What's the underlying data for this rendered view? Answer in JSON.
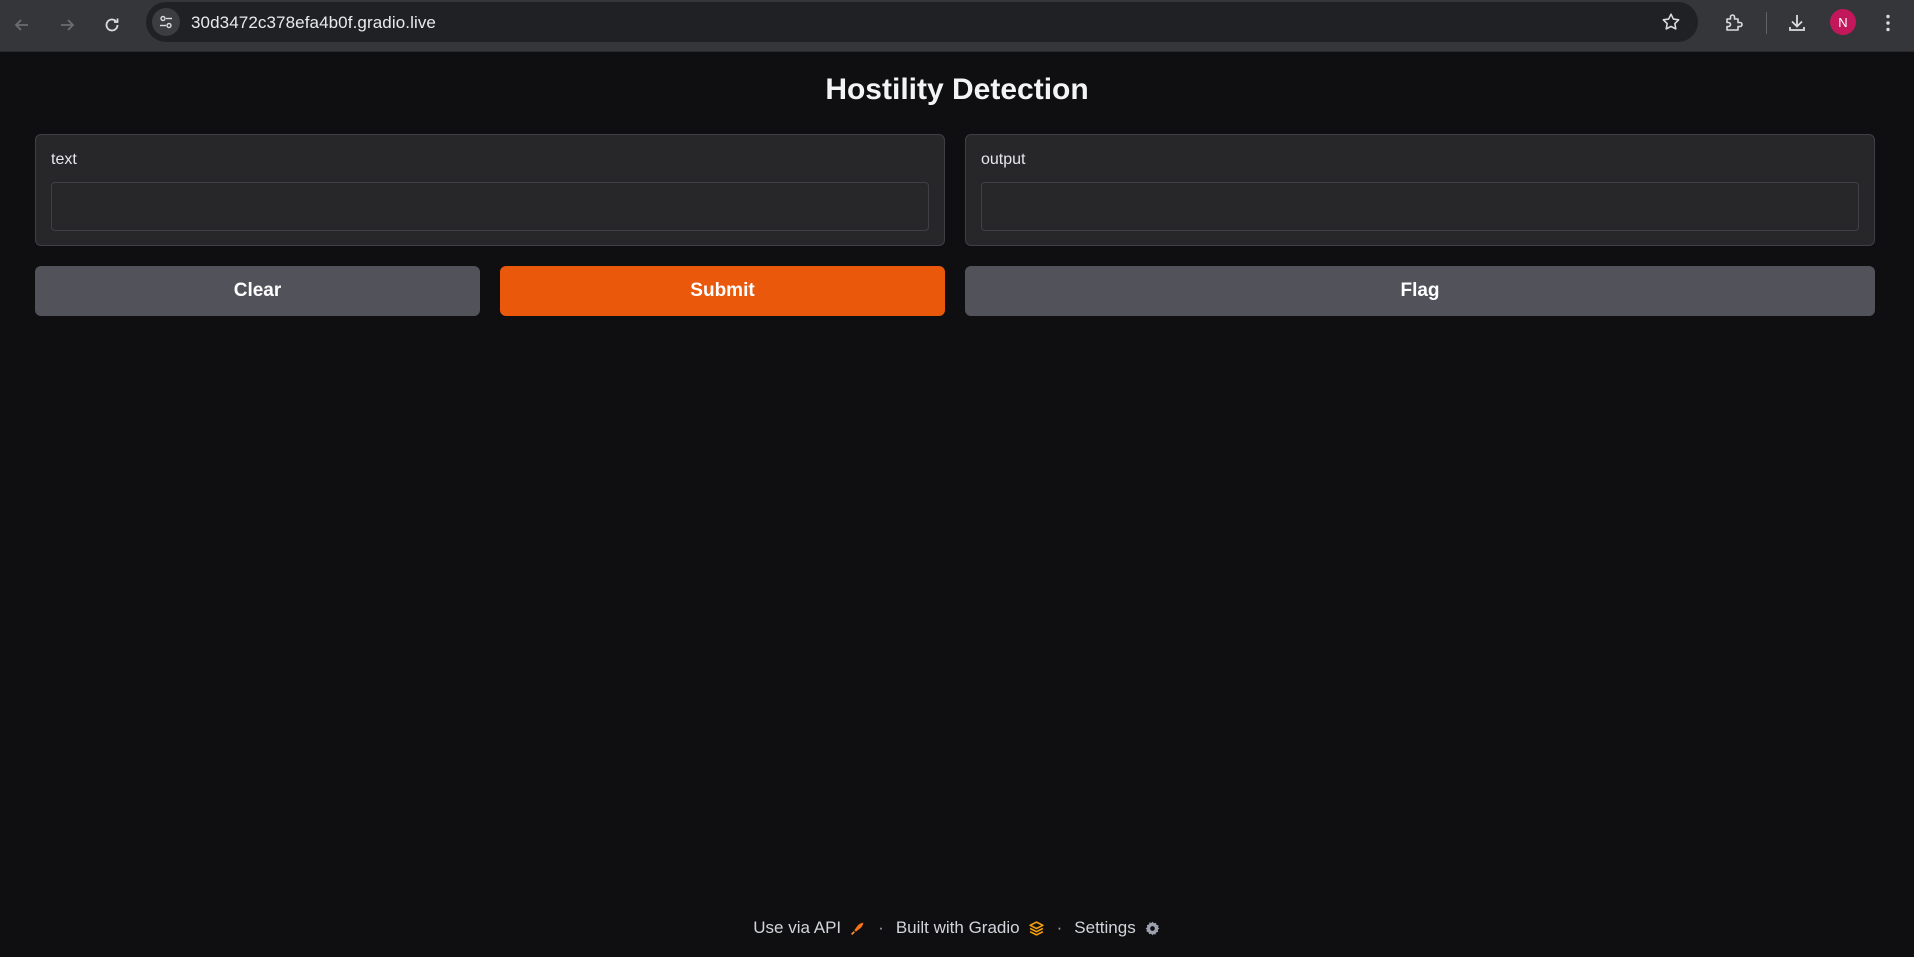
{
  "browser": {
    "url": "30d3472c378efa4b0f.gradio.live",
    "profile_initial": "N",
    "profile_color": "#c2185b"
  },
  "app": {
    "title": "Hostility Detection",
    "input_panel": {
      "label": "text",
      "value": ""
    },
    "output_panel": {
      "label": "output",
      "value": ""
    },
    "buttons": {
      "clear": "Clear",
      "submit": "Submit",
      "flag": "Flag"
    },
    "accent_color": "#ea580c"
  },
  "footer": {
    "api_label": "Use via API",
    "gradio_label": "Built with Gradio",
    "settings_label": "Settings",
    "separator": "·"
  }
}
